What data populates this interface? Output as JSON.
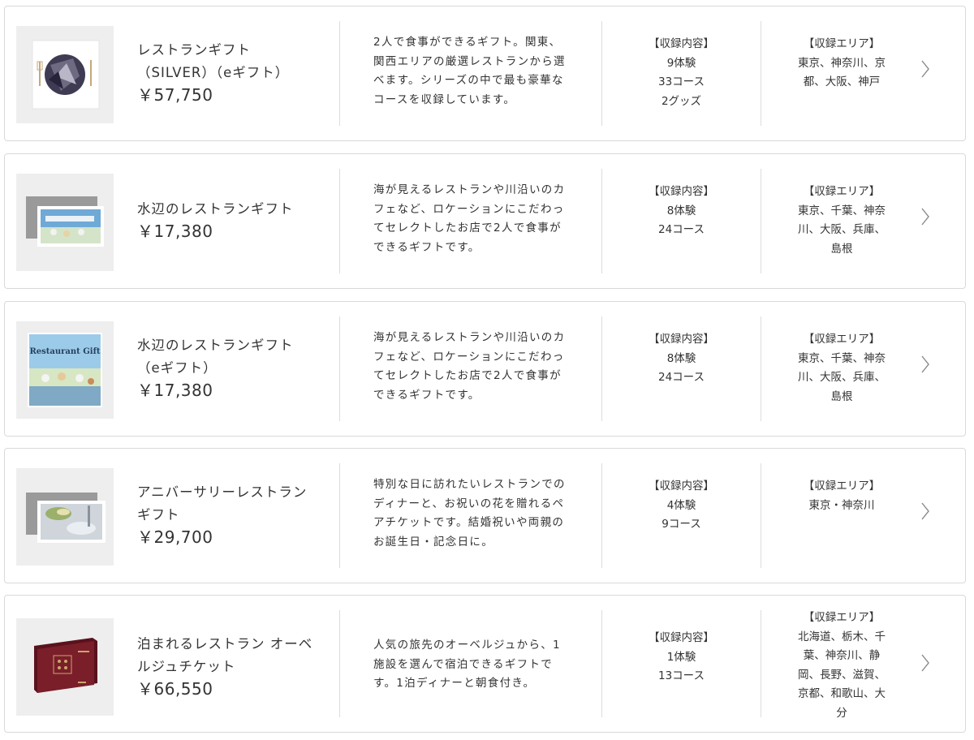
{
  "contents_label": "【収録内容】",
  "area_label": "【収録エリア】",
  "products": [
    {
      "name_lines": [
        "レストランギフト",
        "（SILVER）（eギフト）"
      ],
      "price": "￥57,750",
      "desc_lines": [
        "2人で食事ができるギフト。関東、",
        "関西エリアの厳選レストランから選",
        "べます。シリーズの中で最も豪華な",
        "コースを収録しています。"
      ],
      "contents_lines": [
        "9体験",
        "33コース",
        "2グッズ"
      ],
      "area_lines": [
        "東京、神奈川、京",
        "都、大阪、神戸"
      ],
      "thumb_icon": "silver-plate-image"
    },
    {
      "name_lines": [
        "水辺のレストランギフト"
      ],
      "price": "￥17,380",
      "desc_lines": [
        "海が見えるレストランや川沿いのカ",
        "フェなど、ロケーションにこだわっ",
        "てセレクトしたお店で2人で食事が",
        "できるギフトです。"
      ],
      "contents_lines": [
        "8体験",
        "24コース"
      ],
      "area_lines": [
        "東京、千葉、神奈",
        "川、大阪、兵庫、",
        "島根"
      ],
      "thumb_icon": "waterside-card-image"
    },
    {
      "name_lines": [
        "水辺のレストランギフト",
        "（eギフト）"
      ],
      "price": "￥17,380",
      "desc_lines": [
        "海が見えるレストランや川沿いのカ",
        "フェなど、ロケーションにこだわっ",
        "てセレクトしたお店で2人で食事が",
        "できるギフトです。"
      ],
      "contents_lines": [
        "8体験",
        "24コース"
      ],
      "area_lines": [
        "東京、千葉、神奈",
        "川、大阪、兵庫、",
        "島根"
      ],
      "thumb_icon": "waterside-egift-image",
      "thumb_text": "Restaurant Gift"
    },
    {
      "name_lines": [
        "アニバーサリーレストラン",
        "ギフト"
      ],
      "price": "￥29,700",
      "desc_lines": [
        "特別な日に訪れたいレストランでの",
        "ディナーと、お祝いの花を贈れるペ",
        "アチケットです。結婚祝いや両親の",
        "お誕生日・記念日に。"
      ],
      "contents_lines": [
        "4体験",
        "9コース"
      ],
      "area_lines": [
        "東京・神奈川"
      ],
      "thumb_icon": "anniversary-card-image"
    },
    {
      "name_lines": [
        "泊まれるレストラン オーベ",
        "ルジュチケット"
      ],
      "price": "￥66,550",
      "desc_lines": [
        "人気の旅先のオーベルジュから、1",
        "施設を選んで宿泊できるギフトで",
        "す。1泊ディナーと朝食付き。"
      ],
      "contents_lines": [
        "1体験",
        "13コース"
      ],
      "area_lines": [
        "北海道、栃木、千",
        "葉、神奈川、静",
        "岡、長野、滋賀、",
        "京都、和歌山、大",
        "分"
      ],
      "thumb_icon": "auberge-box-image"
    }
  ],
  "chevron_icon": "chevron-right-icon",
  "colors": {
    "border": "#d9d9d9",
    "text": "#333333",
    "thumb_bg": "#eeeeee",
    "box_red": "#7a1e2a"
  }
}
